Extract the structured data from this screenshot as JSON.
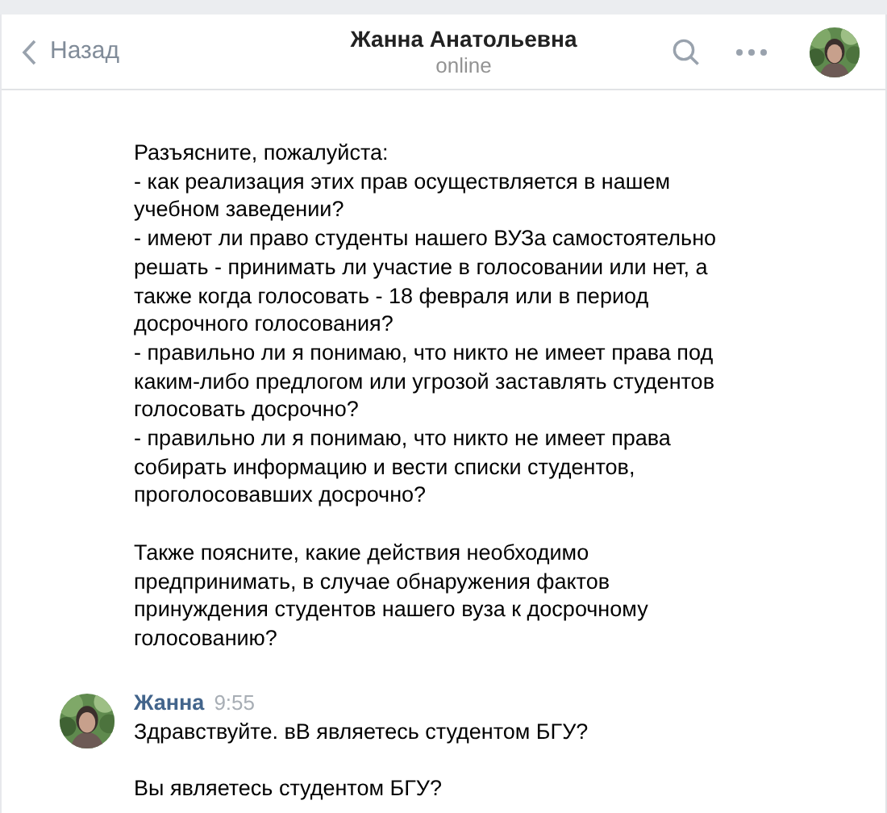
{
  "header": {
    "back_label": "Назад",
    "title": "Жанна Анатольевна",
    "status": "online"
  },
  "messages": [
    {
      "kind": "continued",
      "paragraphs": [
        [
          "Разъясните, пожалуйста:",
          "- как реализация этих прав осуществляется в нашем",
          "учебном заведении?",
          "- имеют ли право студенты нашего ВУЗа самостоятельно",
          "решать - принимать ли участие в голосовании или нет, а",
          "также когда голосовать - 18 февраля или в период",
          "досрочного голосования?",
          "- правильно ли я понимаю, что никто не имеет права под",
          "каким-либо предлогом или угрозой заставлять студентов",
          "голосовать досрочно?",
          "- правильно ли я понимаю, что никто не имеет права",
          "собирать информацию и вести списки студентов,",
          "проголосовавших досрочно?"
        ],
        [
          "Также поясните, какие действия необходимо",
          "предпринимать, в случае обнаружения фактов",
          "принуждения студентов нашего вуза к досрочному",
          "голосованию?"
        ]
      ]
    },
    {
      "kind": "new",
      "author": "Жанна",
      "time": "9:55",
      "paragraphs": [
        [
          "Здравствуйте. вВ являетесь студентом БГУ?"
        ],
        [
          "Вы являетесь студентом БГУ?"
        ]
      ]
    }
  ]
}
